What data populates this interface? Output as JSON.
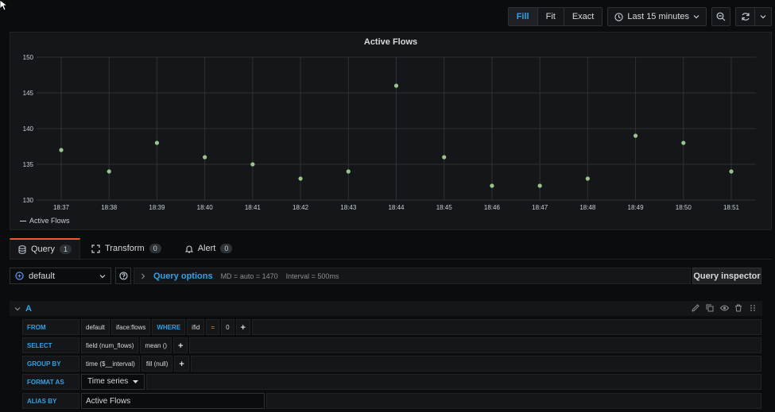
{
  "toolbar": {
    "zoom_modes": [
      "Fill",
      "Fit",
      "Exact"
    ],
    "active_zoom": "Fill",
    "time_range": "Last 15 minutes"
  },
  "panel": {
    "title": "Active Flows",
    "legend": "Active Flows"
  },
  "chart_data": {
    "type": "scatter",
    "title": "Active Flows",
    "categories": [
      "18:37",
      "18:38",
      "18:39",
      "18:40",
      "18:41",
      "18:42",
      "18:43",
      "18:44",
      "18:45",
      "18:46",
      "18:47",
      "18:48",
      "18:49",
      "18:50",
      "18:51"
    ],
    "series": [
      {
        "name": "Active Flows",
        "values": [
          137,
          134,
          138,
          136,
          135,
          133,
          134,
          146,
          136,
          132,
          132,
          133,
          139,
          138,
          134
        ]
      }
    ],
    "y_ticks": [
      130,
      135,
      140,
      145,
      150
    ],
    "ylim": [
      130,
      150
    ],
    "grid": true,
    "legend_position": "bottom-left",
    "point_color": "#9ac48a"
  },
  "tabs": [
    {
      "label": "Query",
      "count": "1",
      "icon": "database-icon"
    },
    {
      "label": "Transform",
      "count": "0",
      "icon": "transform-icon"
    },
    {
      "label": "Alert",
      "count": "0",
      "icon": "bell-icon"
    }
  ],
  "query_bar": {
    "datasource": "default",
    "options_label": "Query options",
    "md": "MD = auto = 1470",
    "interval": "Interval = 500ms",
    "inspector_label": "Query inspector"
  },
  "query": {
    "ref": "A",
    "from_kw": "FROM",
    "from_policy": "default",
    "from_measurement": "iface:flows",
    "where_kw": "WHERE",
    "where_key": "ifid",
    "where_op": "=",
    "where_value": "0",
    "select_kw": "SELECT",
    "select_field": "field (num_flows)",
    "select_agg": "mean ()",
    "groupby_kw": "GROUP BY",
    "groupby_time": "time ($__interval)",
    "groupby_fill": "fill (null)",
    "format_kw": "FORMAT AS",
    "format_value": "Time series",
    "alias_kw": "ALIAS BY",
    "alias_value": "Active Flows",
    "plus": "+"
  }
}
